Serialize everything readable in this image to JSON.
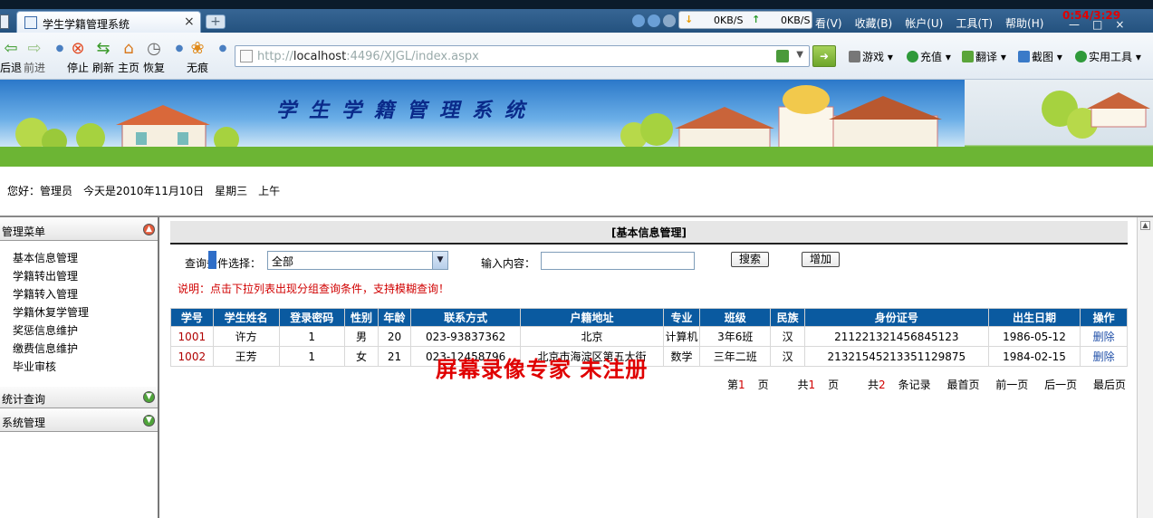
{
  "browser": {
    "tab_title": "学生学籍管理系统",
    "tab_close": "×",
    "new_tab": "+",
    "speed_down": "0KB/S",
    "speed_up": "0KB/S",
    "menu": [
      "看(V)",
      "收藏(B)",
      "帐户(U)",
      "工具(T)",
      "帮助(H)"
    ],
    "clock": "0:54/3:29",
    "toolbar": {
      "back": "后退",
      "forward": "前进",
      "stop": "停止",
      "refresh": "刷新",
      "home": "主页",
      "restore": "恢复",
      "incognito": "无痕"
    },
    "url_host": "localhost",
    "url_rest": ":4496/XJGL/index.aspx",
    "right_tools": [
      "游戏",
      "充值",
      "翻译",
      "截图",
      "实用工具"
    ]
  },
  "banner": {
    "title": "学生学籍管理系统"
  },
  "greeting": {
    "hello": "您好：管理员",
    "date": "今天是2010年11月10日",
    "weekday": "星期三",
    "period": "上午"
  },
  "sidebar": {
    "admin_menu": "管理菜单",
    "items": [
      "基本信息管理",
      "学籍转出管理",
      "学籍转入管理",
      "学籍休复学管理",
      "奖惩信息维护",
      "缴费信息维护",
      "毕业审核"
    ],
    "stats": "统计查询",
    "system": "系统管理"
  },
  "main": {
    "panel_title": "[基本信息管理]",
    "query_label": "查询条件选择：",
    "query_selected": "全部",
    "input_label": "输入内容：",
    "search_btn": "搜索",
    "add_btn": "增加",
    "hint": "说明：点击下拉列表出现分组查询条件，支持模糊查询！",
    "columns": [
      "学号",
      "学生姓名",
      "登录密码",
      "性别",
      "年龄",
      "联系方式",
      "户籍地址",
      "专业",
      "班级",
      "民族",
      "身份证号",
      "出生日期",
      "操作"
    ],
    "rows": [
      [
        "1001",
        "许方",
        "1",
        "男",
        "20",
        "023-93837362",
        "北京",
        "计算机",
        "3年6班",
        "汉",
        "211221321456845123",
        "1986-05-12",
        "删除"
      ],
      [
        "1002",
        "王芳",
        "1",
        "女",
        "21",
        "023-12458796",
        "北京市海淀区第五大街",
        "数学",
        "三年二班",
        "汉",
        "21321545213351129875",
        "1984-02-15",
        "删除"
      ]
    ],
    "watermark": "屏幕录像专家  未注册",
    "pager": {
      "p1a": "第",
      "p1b": "1",
      "p1c": "页",
      "p2a": "共",
      "p2b": "1",
      "p2c": "页",
      "p3a": "共",
      "p3b": "2",
      "p3c": "条记录",
      "first": "最首页",
      "prev": "前一页",
      "next": "后一页",
      "last": "最后页"
    }
  }
}
